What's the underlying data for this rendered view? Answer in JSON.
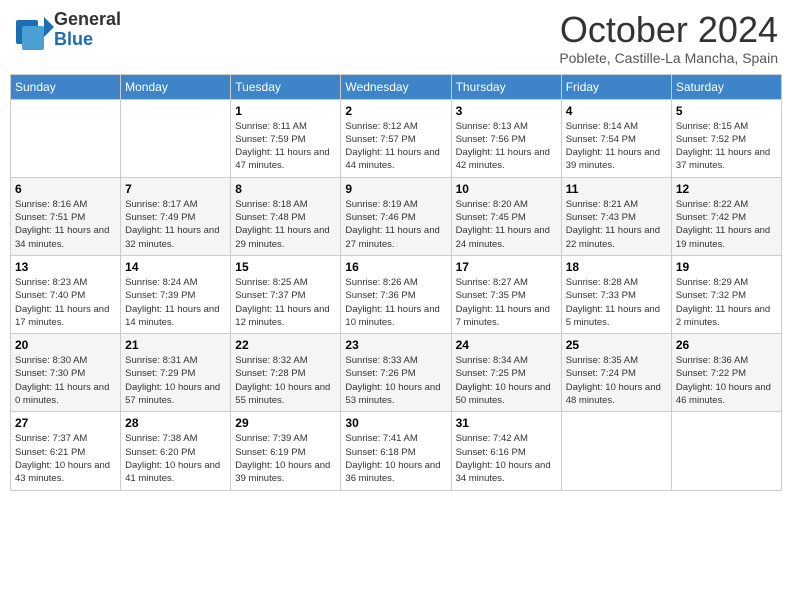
{
  "header": {
    "logo_line1": "General",
    "logo_line2": "Blue",
    "month": "October 2024",
    "location": "Poblete, Castille-La Mancha, Spain"
  },
  "days_of_week": [
    "Sunday",
    "Monday",
    "Tuesday",
    "Wednesday",
    "Thursday",
    "Friday",
    "Saturday"
  ],
  "weeks": [
    [
      {
        "day": "",
        "info": ""
      },
      {
        "day": "",
        "info": ""
      },
      {
        "day": "1",
        "info": "Sunrise: 8:11 AM\nSunset: 7:59 PM\nDaylight: 11 hours and 47 minutes."
      },
      {
        "day": "2",
        "info": "Sunrise: 8:12 AM\nSunset: 7:57 PM\nDaylight: 11 hours and 44 minutes."
      },
      {
        "day": "3",
        "info": "Sunrise: 8:13 AM\nSunset: 7:56 PM\nDaylight: 11 hours and 42 minutes."
      },
      {
        "day": "4",
        "info": "Sunrise: 8:14 AM\nSunset: 7:54 PM\nDaylight: 11 hours and 39 minutes."
      },
      {
        "day": "5",
        "info": "Sunrise: 8:15 AM\nSunset: 7:52 PM\nDaylight: 11 hours and 37 minutes."
      }
    ],
    [
      {
        "day": "6",
        "info": "Sunrise: 8:16 AM\nSunset: 7:51 PM\nDaylight: 11 hours and 34 minutes."
      },
      {
        "day": "7",
        "info": "Sunrise: 8:17 AM\nSunset: 7:49 PM\nDaylight: 11 hours and 32 minutes."
      },
      {
        "day": "8",
        "info": "Sunrise: 8:18 AM\nSunset: 7:48 PM\nDaylight: 11 hours and 29 minutes."
      },
      {
        "day": "9",
        "info": "Sunrise: 8:19 AM\nSunset: 7:46 PM\nDaylight: 11 hours and 27 minutes."
      },
      {
        "day": "10",
        "info": "Sunrise: 8:20 AM\nSunset: 7:45 PM\nDaylight: 11 hours and 24 minutes."
      },
      {
        "day": "11",
        "info": "Sunrise: 8:21 AM\nSunset: 7:43 PM\nDaylight: 11 hours and 22 minutes."
      },
      {
        "day": "12",
        "info": "Sunrise: 8:22 AM\nSunset: 7:42 PM\nDaylight: 11 hours and 19 minutes."
      }
    ],
    [
      {
        "day": "13",
        "info": "Sunrise: 8:23 AM\nSunset: 7:40 PM\nDaylight: 11 hours and 17 minutes."
      },
      {
        "day": "14",
        "info": "Sunrise: 8:24 AM\nSunset: 7:39 PM\nDaylight: 11 hours and 14 minutes."
      },
      {
        "day": "15",
        "info": "Sunrise: 8:25 AM\nSunset: 7:37 PM\nDaylight: 11 hours and 12 minutes."
      },
      {
        "day": "16",
        "info": "Sunrise: 8:26 AM\nSunset: 7:36 PM\nDaylight: 11 hours and 10 minutes."
      },
      {
        "day": "17",
        "info": "Sunrise: 8:27 AM\nSunset: 7:35 PM\nDaylight: 11 hours and 7 minutes."
      },
      {
        "day": "18",
        "info": "Sunrise: 8:28 AM\nSunset: 7:33 PM\nDaylight: 11 hours and 5 minutes."
      },
      {
        "day": "19",
        "info": "Sunrise: 8:29 AM\nSunset: 7:32 PM\nDaylight: 11 hours and 2 minutes."
      }
    ],
    [
      {
        "day": "20",
        "info": "Sunrise: 8:30 AM\nSunset: 7:30 PM\nDaylight: 11 hours and 0 minutes."
      },
      {
        "day": "21",
        "info": "Sunrise: 8:31 AM\nSunset: 7:29 PM\nDaylight: 10 hours and 57 minutes."
      },
      {
        "day": "22",
        "info": "Sunrise: 8:32 AM\nSunset: 7:28 PM\nDaylight: 10 hours and 55 minutes."
      },
      {
        "day": "23",
        "info": "Sunrise: 8:33 AM\nSunset: 7:26 PM\nDaylight: 10 hours and 53 minutes."
      },
      {
        "day": "24",
        "info": "Sunrise: 8:34 AM\nSunset: 7:25 PM\nDaylight: 10 hours and 50 minutes."
      },
      {
        "day": "25",
        "info": "Sunrise: 8:35 AM\nSunset: 7:24 PM\nDaylight: 10 hours and 48 minutes."
      },
      {
        "day": "26",
        "info": "Sunrise: 8:36 AM\nSunset: 7:22 PM\nDaylight: 10 hours and 46 minutes."
      }
    ],
    [
      {
        "day": "27",
        "info": "Sunrise: 7:37 AM\nSunset: 6:21 PM\nDaylight: 10 hours and 43 minutes."
      },
      {
        "day": "28",
        "info": "Sunrise: 7:38 AM\nSunset: 6:20 PM\nDaylight: 10 hours and 41 minutes."
      },
      {
        "day": "29",
        "info": "Sunrise: 7:39 AM\nSunset: 6:19 PM\nDaylight: 10 hours and 39 minutes."
      },
      {
        "day": "30",
        "info": "Sunrise: 7:41 AM\nSunset: 6:18 PM\nDaylight: 10 hours and 36 minutes."
      },
      {
        "day": "31",
        "info": "Sunrise: 7:42 AM\nSunset: 6:16 PM\nDaylight: 10 hours and 34 minutes."
      },
      {
        "day": "",
        "info": ""
      },
      {
        "day": "",
        "info": ""
      }
    ]
  ]
}
